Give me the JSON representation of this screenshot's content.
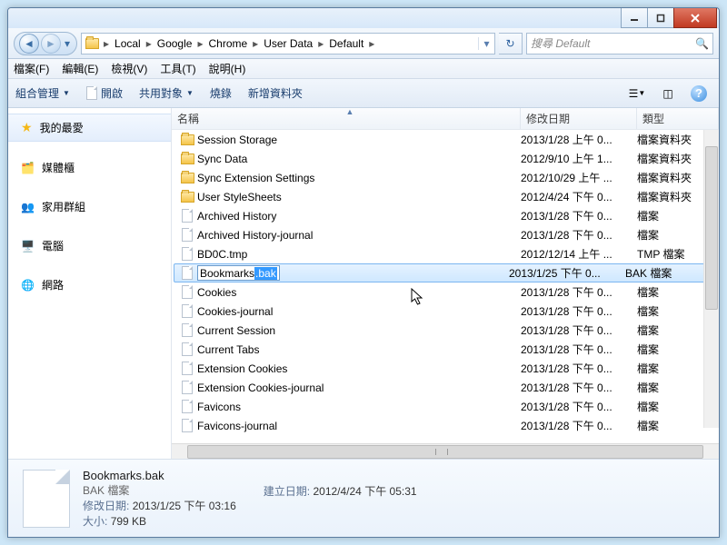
{
  "titlebar": {
    "min": "–",
    "max": "▢",
    "close": "✕"
  },
  "nav": {
    "crumbs": [
      "Local",
      "Google",
      "Chrome",
      "User Data",
      "Default"
    ],
    "refresh": "↻",
    "search_placeholder": "搜尋 Default"
  },
  "menu": {
    "file": "檔案(F)",
    "edit": "編輯(E)",
    "view": "檢視(V)",
    "tools": "工具(T)",
    "help": "說明(H)"
  },
  "toolbar": {
    "organize": "組合管理",
    "open": "開啟",
    "share": "共用對象",
    "burn": "燒錄",
    "newfolder": "新增資料夾"
  },
  "sidebar": {
    "favorites": "我的最愛",
    "libraries": "媒體櫃",
    "homegroup": "家用群組",
    "computer": "電腦",
    "network": "網路"
  },
  "columns": {
    "name": "名稱",
    "date": "修改日期",
    "type": "類型"
  },
  "files": [
    {
      "name": "Session Storage",
      "date": "2013/1/28 上午 0...",
      "type": "檔案資料夾",
      "kind": "folder"
    },
    {
      "name": "Sync Data",
      "date": "2012/9/10 上午 1...",
      "type": "檔案資料夾",
      "kind": "folder"
    },
    {
      "name": "Sync Extension Settings",
      "date": "2012/10/29 上午 ...",
      "type": "檔案資料夾",
      "kind": "folder"
    },
    {
      "name": "User StyleSheets",
      "date": "2012/4/24 下午 0...",
      "type": "檔案資料夾",
      "kind": "folder"
    },
    {
      "name": "Archived History",
      "date": "2013/1/28 下午 0...",
      "type": "檔案",
      "kind": "file"
    },
    {
      "name": "Archived History-journal",
      "date": "2013/1/28 下午 0...",
      "type": "檔案",
      "kind": "file"
    },
    {
      "name": "BD0C.tmp",
      "date": "2012/12/14 上午 ...",
      "type": "TMP 檔案",
      "kind": "file"
    },
    {
      "name": "Bookmarks.bak",
      "date": "2013/1/25 下午 0...",
      "type": "BAK 檔案",
      "kind": "file",
      "selected": true,
      "rename_prefix": "Bookmarks",
      "rename_selected": ".bak"
    },
    {
      "name": "Cookies",
      "date": "2013/1/28 下午 0...",
      "type": "檔案",
      "kind": "file"
    },
    {
      "name": "Cookies-journal",
      "date": "2013/1/28 下午 0...",
      "type": "檔案",
      "kind": "file"
    },
    {
      "name": "Current Session",
      "date": "2013/1/28 下午 0...",
      "type": "檔案",
      "kind": "file"
    },
    {
      "name": "Current Tabs",
      "date": "2013/1/28 下午 0...",
      "type": "檔案",
      "kind": "file"
    },
    {
      "name": "Extension Cookies",
      "date": "2013/1/28 下午 0...",
      "type": "檔案",
      "kind": "file"
    },
    {
      "name": "Extension Cookies-journal",
      "date": "2013/1/28 下午 0...",
      "type": "檔案",
      "kind": "file"
    },
    {
      "name": "Favicons",
      "date": "2013/1/28 下午 0...",
      "type": "檔案",
      "kind": "file"
    },
    {
      "name": "Favicons-journal",
      "date": "2013/1/28 下午 0...",
      "type": "檔案",
      "kind": "file"
    }
  ],
  "details": {
    "filename": "Bookmarks.bak",
    "filetype": "BAK 檔案",
    "modified_label": "修改日期:",
    "modified": "2013/1/25 下午 03:16",
    "size_label": "大小:",
    "size": "799 KB",
    "created_label": "建立日期:",
    "created": "2012/4/24 下午 05:31"
  }
}
